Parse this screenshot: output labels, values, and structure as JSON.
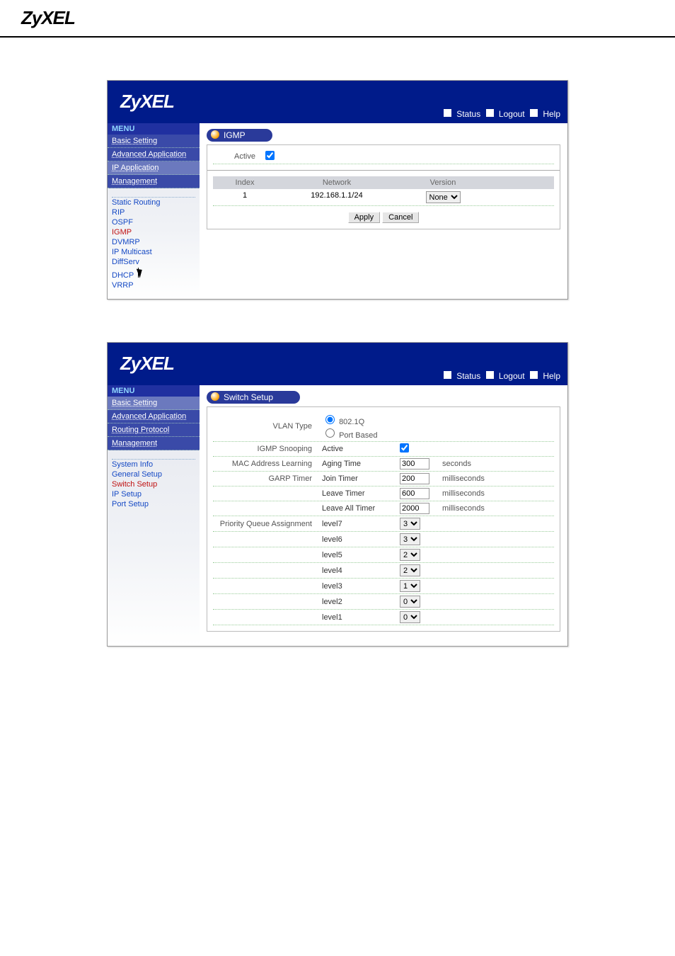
{
  "doc_logo": "ZyXEL",
  "top_bar": {
    "status": "Status",
    "logout": "Logout",
    "help": "Help"
  },
  "shot1": {
    "menu_header": "MENU",
    "sections": [
      "Basic Setting",
      "Advanced Application",
      "IP Application",
      "Management"
    ],
    "submenu": [
      "Static Routing",
      "RIP",
      "OSPF",
      "IGMP",
      "DVMRP",
      "IP Multicast",
      "DiffServ",
      "DHCP",
      "VRRP"
    ],
    "active_idx": 3,
    "title": "IGMP",
    "active_label": "Active",
    "active_checked": true,
    "table": {
      "headers": {
        "index": "Index",
        "network": "Network",
        "version": "Version"
      },
      "row": {
        "index": "1",
        "network": "192.168.1.1/24",
        "version": "None"
      }
    },
    "buttons": {
      "apply": "Apply",
      "cancel": "Cancel"
    }
  },
  "shot2": {
    "menu_header": "MENU",
    "sections": [
      "Basic Setting",
      "Advanced Application",
      "Routing Protocol",
      "Management"
    ],
    "submenu": [
      "System Info",
      "General Setup",
      "Switch Setup",
      "IP Setup",
      "Port Setup"
    ],
    "active_idx": 2,
    "title": "Switch Setup",
    "vlan": {
      "label": "VLAN Type",
      "opt1": "802.1Q",
      "opt2": "Port Based"
    },
    "igmp": {
      "label": "IGMP Snooping",
      "field": "Active",
      "checked": true
    },
    "mac": {
      "label": "MAC Address Learning",
      "field": "Aging Time",
      "value": "300",
      "unit": "seconds"
    },
    "garp": {
      "label": "GARP Timer",
      "join": {
        "field": "Join Timer",
        "value": "200",
        "unit": "milliseconds"
      },
      "leave": {
        "field": "Leave Timer",
        "value": "600",
        "unit": "milliseconds"
      },
      "leaveall": {
        "field": "Leave All Timer",
        "value": "2000",
        "unit": "milliseconds"
      }
    },
    "pq": {
      "label": "Priority Queue Assignment",
      "levels": [
        {
          "name": "level7",
          "value": "3"
        },
        {
          "name": "level6",
          "value": "3"
        },
        {
          "name": "level5",
          "value": "2"
        },
        {
          "name": "level4",
          "value": "2"
        },
        {
          "name": "level3",
          "value": "1"
        },
        {
          "name": "level2",
          "value": "0"
        },
        {
          "name": "level1",
          "value": "0"
        }
      ]
    }
  }
}
